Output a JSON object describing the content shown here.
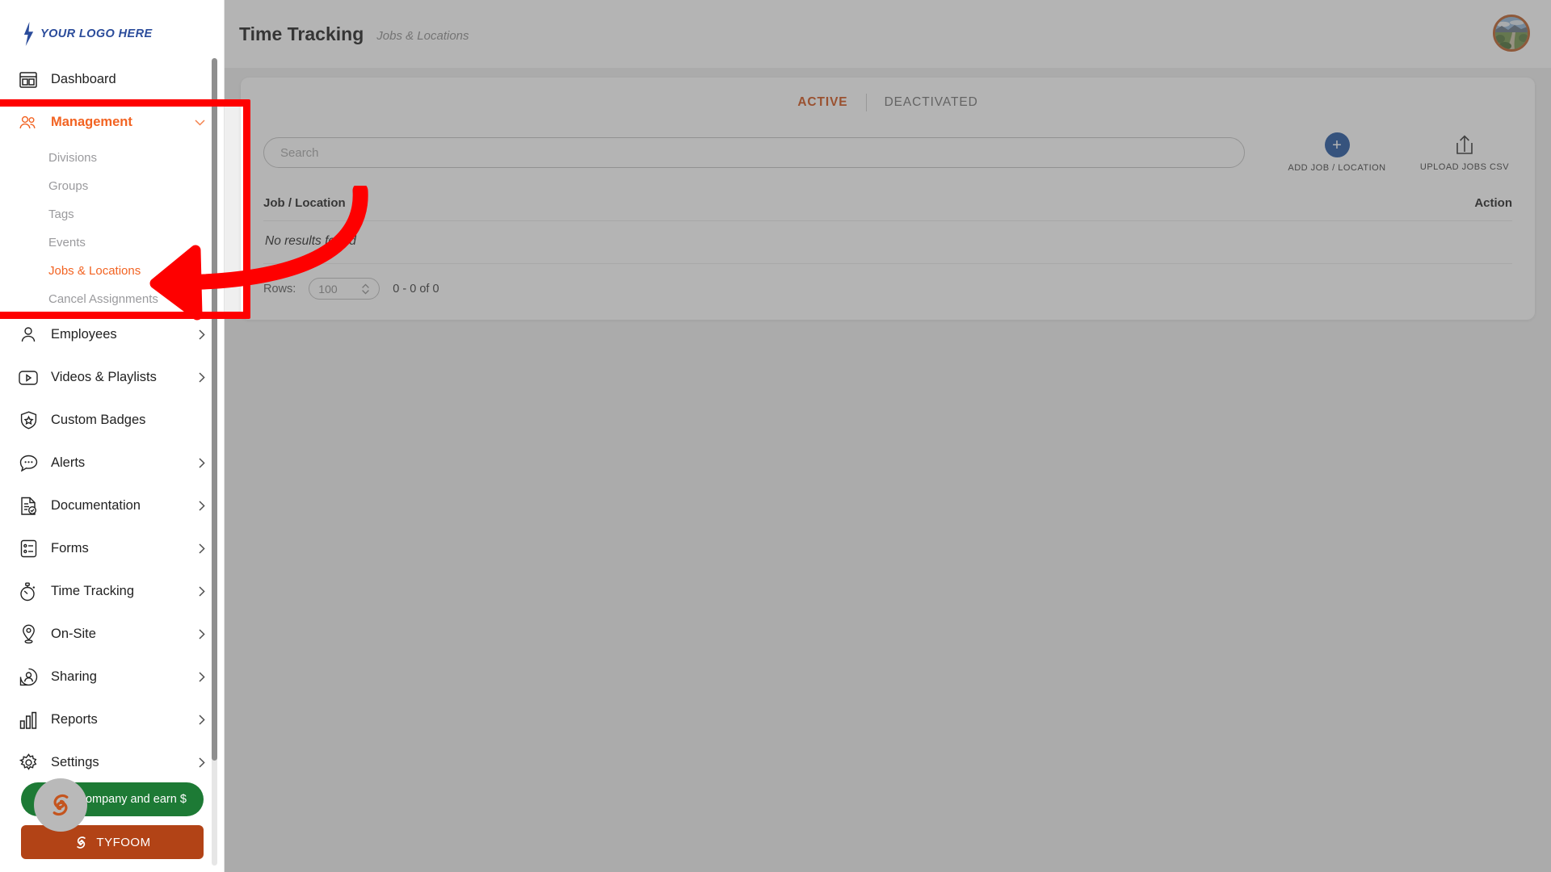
{
  "brand": {
    "logo_text": "YOUR LOGO HERE",
    "logo_color": "#2b4c9b",
    "accent_orange": "#f26322",
    "tab_active_color": "#cf4c10",
    "add_button_color": "#1b4f9c",
    "annotation_color": "#fe0000"
  },
  "header": {
    "title": "Time Tracking",
    "subtitle": "Jobs & Locations"
  },
  "sidebar": {
    "items": [
      {
        "label": "Dashboard",
        "icon": "dashboard-icon",
        "has_chevron": false,
        "expanded": false
      },
      {
        "label": "Management",
        "icon": "management-icon",
        "has_chevron": true,
        "expanded": true
      },
      {
        "label": "Employees",
        "icon": "employees-icon",
        "has_chevron": true,
        "expanded": false
      },
      {
        "label": "Videos & Playlists",
        "icon": "video-icon",
        "has_chevron": true,
        "expanded": false
      },
      {
        "label": "Custom Badges",
        "icon": "badge-icon",
        "has_chevron": false,
        "expanded": false
      },
      {
        "label": "Alerts",
        "icon": "alerts-icon",
        "has_chevron": true,
        "expanded": false
      },
      {
        "label": "Documentation",
        "icon": "documentation-icon",
        "has_chevron": true,
        "expanded": false
      },
      {
        "label": "Forms",
        "icon": "forms-icon",
        "has_chevron": true,
        "expanded": false
      },
      {
        "label": "Time Tracking",
        "icon": "stopwatch-icon",
        "has_chevron": true,
        "expanded": false
      },
      {
        "label": "On-Site",
        "icon": "map-pin-icon",
        "has_chevron": true,
        "expanded": false
      },
      {
        "label": "Sharing",
        "icon": "sharing-icon",
        "has_chevron": true,
        "expanded": false
      },
      {
        "label": "Reports",
        "icon": "reports-icon",
        "has_chevron": true,
        "expanded": false
      },
      {
        "label": "Settings",
        "icon": "gear-icon",
        "has_chevron": true,
        "expanded": false
      }
    ],
    "management_submenu": [
      {
        "label": "Divisions",
        "active": false
      },
      {
        "label": "Groups",
        "active": false
      },
      {
        "label": "Tags",
        "active": false
      },
      {
        "label": "Events",
        "active": false
      },
      {
        "label": "Jobs & Locations",
        "active": true
      },
      {
        "label": "Cancel Assignments",
        "active": false
      }
    ],
    "refer_button": "Refer a company and earn $",
    "tyfoom_button": "TYFOOM"
  },
  "main": {
    "tabs": [
      {
        "label": "ACTIVE",
        "active": true
      },
      {
        "label": "DEACTIVATED",
        "active": false
      }
    ],
    "search": {
      "value": "",
      "placeholder": "Search"
    },
    "actions": [
      {
        "label": "ADD JOB / LOCATION",
        "icon": "plus-icon"
      },
      {
        "label": "UPLOAD JOBS CSV",
        "icon": "upload-icon"
      }
    ],
    "table": {
      "columns": [
        {
          "label": "Job / Location",
          "sortable": true
        },
        {
          "label": "Action",
          "sortable": false
        }
      ],
      "empty_message": "No results found",
      "rows": []
    },
    "pagination": {
      "rows_label": "Rows:",
      "rows_value": "100",
      "range_text": "0 - 0 of 0"
    }
  },
  "annotation": {
    "shape": "rounded-rectangle-with-curved-arrow",
    "target": "Jobs & Locations",
    "color": "#fe0000"
  }
}
